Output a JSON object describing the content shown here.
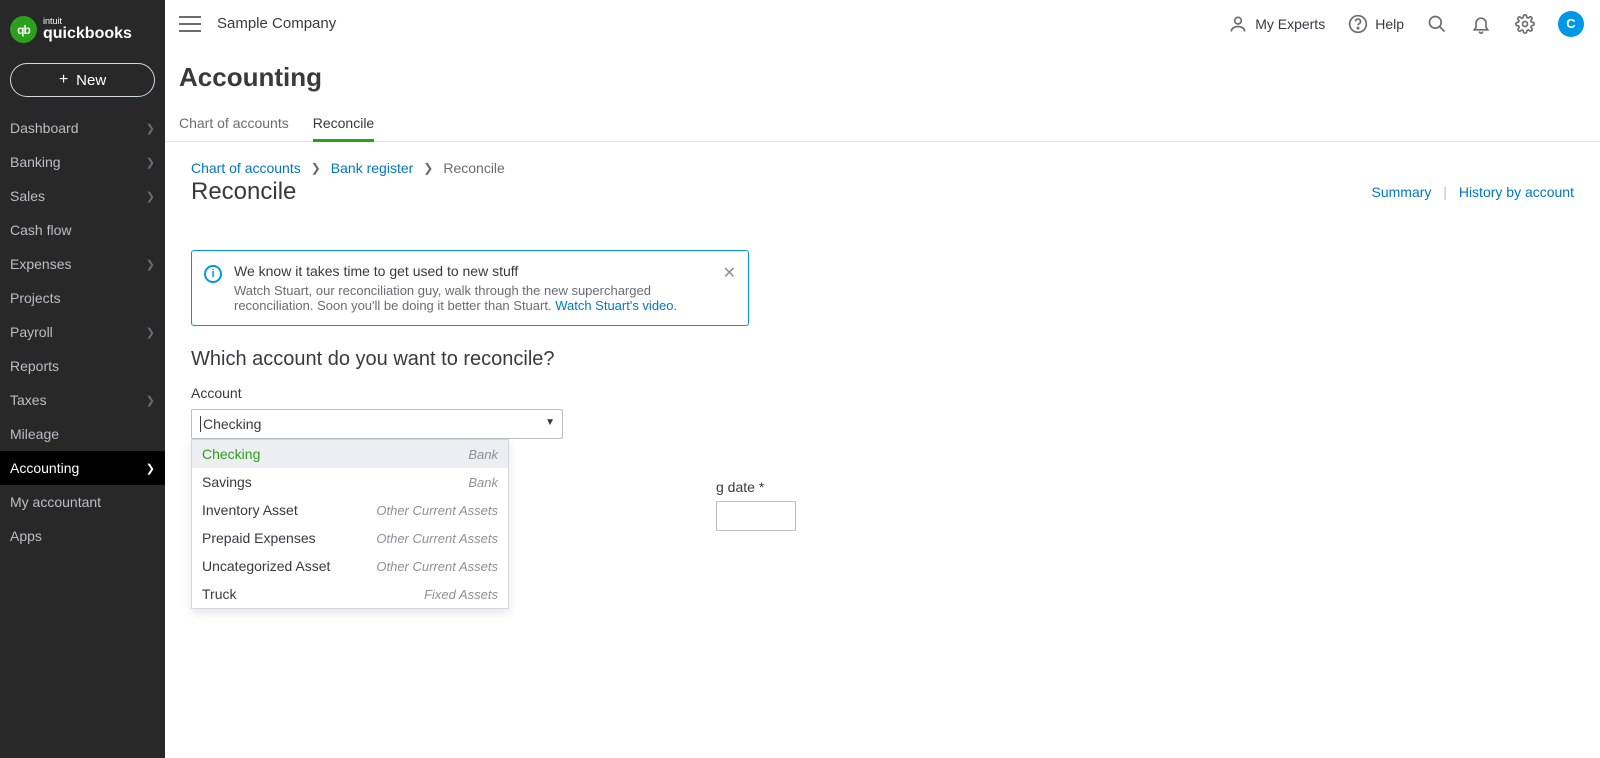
{
  "brand": {
    "intuit": "intuit",
    "product": "quickbooks",
    "glyph": "qb"
  },
  "sidebar": {
    "new_label": "New",
    "items": [
      {
        "label": "Dashboard",
        "chevron": true
      },
      {
        "label": "Banking",
        "chevron": true
      },
      {
        "label": "Sales",
        "chevron": true
      },
      {
        "label": "Cash flow",
        "chevron": false
      },
      {
        "label": "Expenses",
        "chevron": true
      },
      {
        "label": "Projects",
        "chevron": false
      },
      {
        "label": "Payroll",
        "chevron": true
      },
      {
        "label": "Reports",
        "chevron": false
      },
      {
        "label": "Taxes",
        "chevron": true
      },
      {
        "label": "Mileage",
        "chevron": false
      },
      {
        "label": "Accounting",
        "chevron": true,
        "active": true
      },
      {
        "label": "My accountant",
        "chevron": false
      },
      {
        "label": "Apps",
        "chevron": false
      }
    ]
  },
  "topbar": {
    "company": "Sample Company",
    "my_experts": "My Experts",
    "help": "Help",
    "avatar_initial": "C"
  },
  "page": {
    "title": "Accounting",
    "tabs": [
      {
        "label": "Chart of accounts",
        "active": false
      },
      {
        "label": "Reconcile",
        "active": true
      }
    ],
    "breadcrumbs": {
      "items": [
        "Chart of accounts",
        "Bank register",
        "Reconcile"
      ],
      "item0": "Chart of accounts",
      "item1": "Bank register",
      "item2": "Reconcile"
    },
    "subtitle": "Reconcile",
    "right_links": {
      "summary": "Summary",
      "history": "History by account"
    },
    "info": {
      "title": "We know it takes time to get used to new stuff",
      "body": "Watch Stuart, our reconciliation guy, walk through the new supercharged reconciliation. Soon you'll be doing it better than Stuart. ",
      "link": "Watch Stuart's video."
    },
    "prompt": "Which account do you want to reconcile?",
    "account_label": "Account",
    "account_value": "Checking",
    "ending_date_label": "g date *",
    "dropdown": [
      {
        "name": "Checking",
        "type": "Bank",
        "selected": true
      },
      {
        "name": "Savings",
        "type": "Bank"
      },
      {
        "name": "Inventory Asset",
        "type": "Other Current Assets"
      },
      {
        "name": "Prepaid Expenses",
        "type": "Other Current Assets"
      },
      {
        "name": "Uncategorized Asset",
        "type": "Other Current Assets"
      },
      {
        "name": "Truck",
        "type": "Fixed Assets"
      }
    ]
  }
}
